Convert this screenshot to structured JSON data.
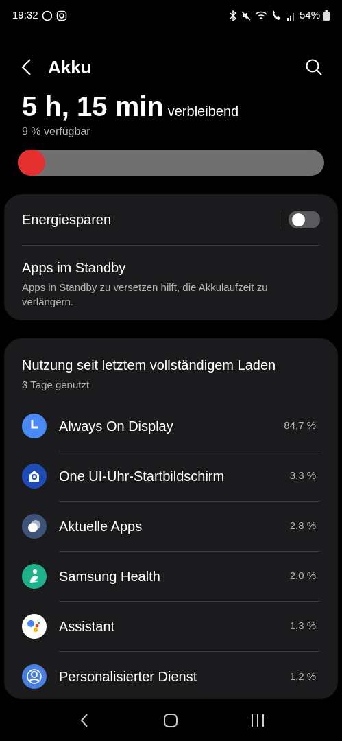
{
  "status_bar": {
    "time": "19:32",
    "battery": "54%"
  },
  "header": {
    "title": "Akku"
  },
  "summary": {
    "remaining": "5 h, 15 min",
    "remaining_suffix": "verbleibend",
    "available": "9 % verfügbar",
    "level": 0.09
  },
  "settings": [
    {
      "kind": "toggle",
      "title": "Energiesparen",
      "on": false
    },
    {
      "kind": "link",
      "title": "Apps im Standby",
      "subtitle": "Apps in Standby zu versetzen hilft, die Akkulaufzeit zu verlängern."
    }
  ],
  "usage": {
    "title": "Nutzung seit letztem vollständigem Laden",
    "subtitle": "3 Tage genutzt",
    "apps": [
      {
        "name": "Always On Display",
        "share": "84,7 %"
      },
      {
        "name": "One UI-Uhr-Startbildschirm",
        "share": "3,3 %"
      },
      {
        "name": "Aktuelle Apps",
        "share": "2,8 %"
      },
      {
        "name": "Samsung Health",
        "share": "2,0 %"
      },
      {
        "name": "Assistant",
        "share": "1,3 %"
      },
      {
        "name": "Personalisierter Dienst",
        "share": "1,2 %"
      }
    ]
  }
}
